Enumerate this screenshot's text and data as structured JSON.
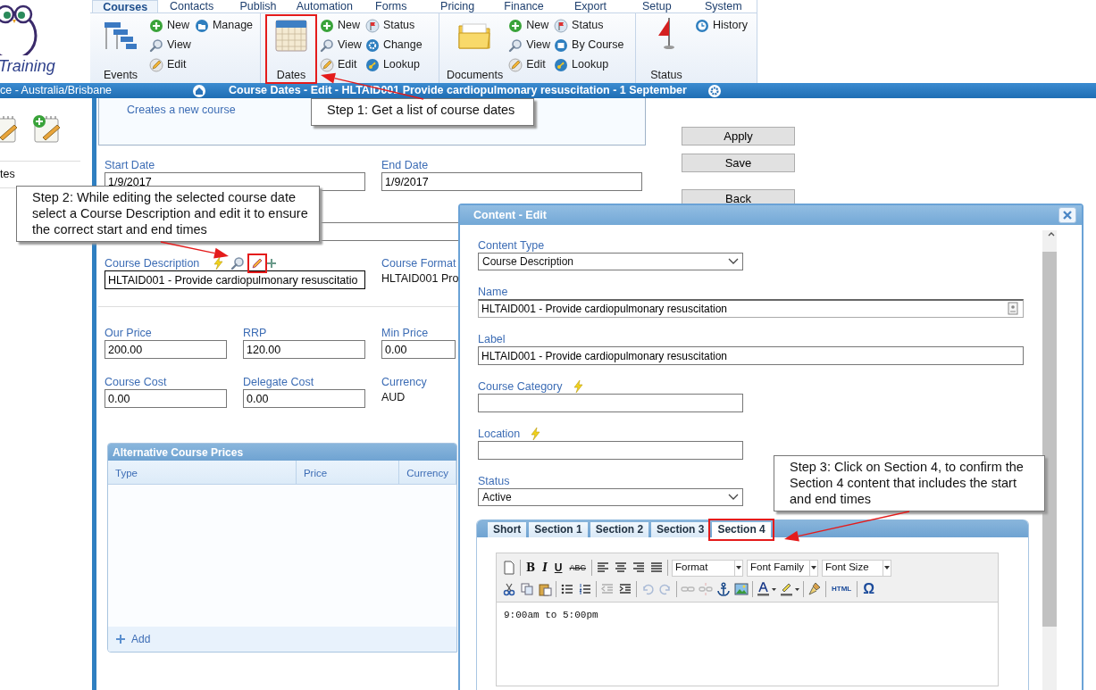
{
  "logo": {
    "text": "Training"
  },
  "ribbon": {
    "tabs": [
      {
        "label": "Courses",
        "selected": true
      },
      {
        "label": "Contacts",
        "selected": false
      },
      {
        "label": "Publish",
        "selected": false
      },
      {
        "label": "Automation",
        "selected": false
      },
      {
        "label": "Forms",
        "selected": false
      },
      {
        "label": "Pricing",
        "selected": false
      },
      {
        "label": "Finance",
        "selected": false
      },
      {
        "label": "Export",
        "selected": false
      },
      {
        "label": "Setup",
        "selected": false
      },
      {
        "label": "System",
        "selected": false
      }
    ],
    "groups": [
      {
        "button": {
          "label": "Events",
          "highlighted": false
        },
        "columns": [
          [
            "New",
            "View",
            "Edit"
          ],
          [
            "Manage"
          ]
        ]
      },
      {
        "button": {
          "label": "Dates",
          "highlighted": true
        },
        "columns": [
          [
            "New",
            "View",
            "Edit"
          ],
          [
            "Status",
            "Change",
            "Lookup"
          ]
        ]
      },
      {
        "button": {
          "label": "Documents",
          "highlighted": false
        },
        "columns": [
          [
            "New",
            "View",
            "Edit"
          ],
          [
            "Status",
            "By Course",
            "Lookup"
          ]
        ]
      },
      {
        "button": {
          "label": "Status",
          "highlighted": false
        },
        "columns": [
          [
            "History"
          ]
        ]
      }
    ]
  },
  "location_bar": {
    "timezone": "ce - Australia/Brisbane",
    "title": "Course Dates - Edit - HLTAID001 Provide cardiopulmonary resuscitation - 1 September"
  },
  "sidebar": {
    "item": "tes"
  },
  "info_panel": {
    "text": "Creates a new course"
  },
  "actions": [
    "Apply",
    "Save",
    "Back"
  ],
  "form": {
    "dates": [
      {
        "label": "Start Date",
        "value": "1/9/2017"
      },
      {
        "label": "End Date",
        "value": "1/9/2017"
      }
    ],
    "description": {
      "label": "Course Description",
      "value": "HLTAID001 - Provide cardiopulmonary resuscitatio",
      "edit_highlighted": true
    },
    "format": {
      "label": "Course Format",
      "value": "HLTAID001 Pro"
    },
    "prices": [
      {
        "label": "Our Price",
        "value": "200.00"
      },
      {
        "label": "RRP",
        "value": "120.00"
      },
      {
        "label": "Min Price",
        "value": "0.00"
      }
    ],
    "costs": [
      {
        "label": "Course Cost",
        "value": "0.00"
      },
      {
        "label": "Delegate Cost",
        "value": "0.00"
      }
    ],
    "currency": {
      "label": "Currency",
      "value": "AUD"
    }
  },
  "price_table": {
    "title": "Alternative Course Prices",
    "columns": [
      "Type",
      "Price",
      "Currency"
    ],
    "add": "Add"
  },
  "dialog": {
    "title": "Content - Edit",
    "fields": [
      {
        "label": "Content Type",
        "kind": "select",
        "value": "Course Description"
      },
      {
        "label": "Name",
        "kind": "picker",
        "value": "HLTAID001 - Provide cardiopulmonary resuscitation"
      },
      {
        "label": "Label",
        "kind": "text",
        "value": "HLTAID001 - Provide cardiopulmonary resuscitation"
      },
      {
        "label": "Course Category",
        "kind": "lookup"
      },
      {
        "label": "Location",
        "kind": "lookup"
      },
      {
        "label": "Status",
        "kind": "select",
        "value": "Active"
      }
    ],
    "tabs": [
      {
        "label": "Short",
        "selected": false,
        "highlighted": false
      },
      {
        "label": "Section 1",
        "selected": false,
        "highlighted": false
      },
      {
        "label": "Section 2",
        "selected": false,
        "highlighted": false
      },
      {
        "label": "Section 3",
        "selected": false,
        "highlighted": false
      },
      {
        "label": "Section 4",
        "selected": true,
        "highlighted": true
      }
    ],
    "toolbar": [
      [
        {
          "kind": "icon",
          "disabled": false
        },
        {
          "kind": "sep"
        },
        {
          "kind": "glyph",
          "label": "B"
        },
        {
          "kind": "glyph",
          "label": "I"
        },
        {
          "kind": "glyph",
          "label": "U"
        },
        {
          "kind": "glyph",
          "label": "ABC"
        },
        {
          "kind": "sep"
        },
        {
          "kind": "icon",
          "disabled": false
        },
        {
          "kind": "icon",
          "disabled": false
        },
        {
          "kind": "icon",
          "disabled": false
        },
        {
          "kind": "icon",
          "disabled": false
        },
        {
          "kind": "sep"
        },
        {
          "kind": "dropdown",
          "label": "Format"
        },
        {
          "kind": "dropdown",
          "label": "Font Family"
        },
        {
          "kind": "dropdown",
          "label": "Font Size"
        }
      ],
      [
        {
          "kind": "icon",
          "disabled": false
        },
        {
          "kind": "icon",
          "disabled": false
        },
        {
          "kind": "icon",
          "disabled": false
        },
        {
          "kind": "sep"
        },
        {
          "kind": "icon",
          "disabled": false
        },
        {
          "kind": "icon",
          "disabled": false
        },
        {
          "kind": "sep"
        },
        {
          "kind": "icon",
          "disabled": true
        },
        {
          "kind": "icon",
          "disabled": false
        },
        {
          "kind": "sep"
        },
        {
          "kind": "icon",
          "disabled": true
        },
        {
          "kind": "icon",
          "disabled": true
        },
        {
          "kind": "sep"
        },
        {
          "kind": "icon",
          "disabled": true
        },
        {
          "kind": "icon",
          "disabled": true
        },
        {
          "kind": "icon",
          "disabled": false
        },
        {
          "kind": "icon",
          "disabled": false
        },
        {
          "kind": "sep"
        },
        {
          "kind": "icon",
          "disabled": false
        },
        {
          "kind": "icon",
          "disabled": false
        },
        {
          "kind": "sep"
        },
        {
          "kind": "icon",
          "disabled": false
        },
        {
          "kind": "sep"
        },
        {
          "kind": "glyph",
          "label": "HTML"
        },
        {
          "kind": "sep"
        },
        {
          "kind": "glyph",
          "label": "Ω"
        }
      ]
    ],
    "content": "9:00am to 5:00pm"
  },
  "callouts": [
    {
      "text": "Step 1: Get a list of course dates"
    },
    {
      "text": "Step 2: While editing the selected course date select a Course Description and edit it to ensure the correct start and end times"
    },
    {
      "text": "Step 3: Click on Section 4, to confirm the Section 4 content that includes the start and end times"
    }
  ]
}
